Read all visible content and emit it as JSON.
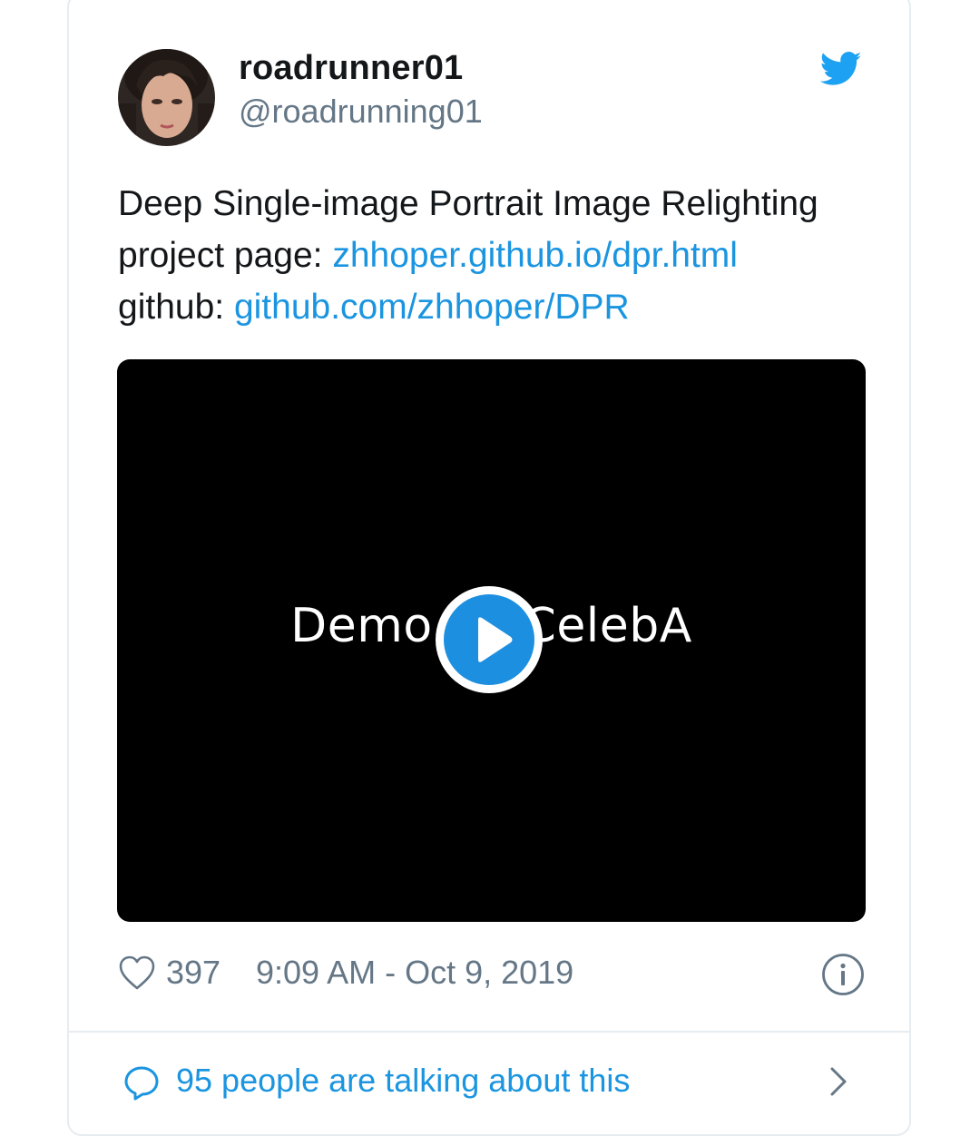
{
  "tweet": {
    "user": {
      "name": "roadrunner01",
      "handle": "@roadrunning01"
    },
    "text": {
      "line1": "Deep Single-image Portrait Image Relighting",
      "line2_prefix": "project page: ",
      "line2_link": "zhhoper.github.io/dpr.html",
      "line3_prefix": "github: ",
      "line3_link": "github.com/zhhoper/DPR"
    },
    "media": {
      "title_text": "Demo on CelebA"
    },
    "meta": {
      "likes": "397",
      "timestamp": "9:09 AM - Oct 9, 2019"
    },
    "footer": {
      "talking_label": "95 people are talking about this"
    }
  },
  "icons": {
    "brand": "twitter-bird-icon",
    "like": "heart-icon",
    "info": "info-icon",
    "conversation": "chat-bubble-icon",
    "more": "chevron-right-icon",
    "play": "play-icon"
  },
  "colors": {
    "link": "#1b95e0",
    "muted": "#657786",
    "text": "#14171a",
    "border": "#e6ecf0",
    "play_blue": "#1d8fe0",
    "media_bg": "#000000"
  }
}
